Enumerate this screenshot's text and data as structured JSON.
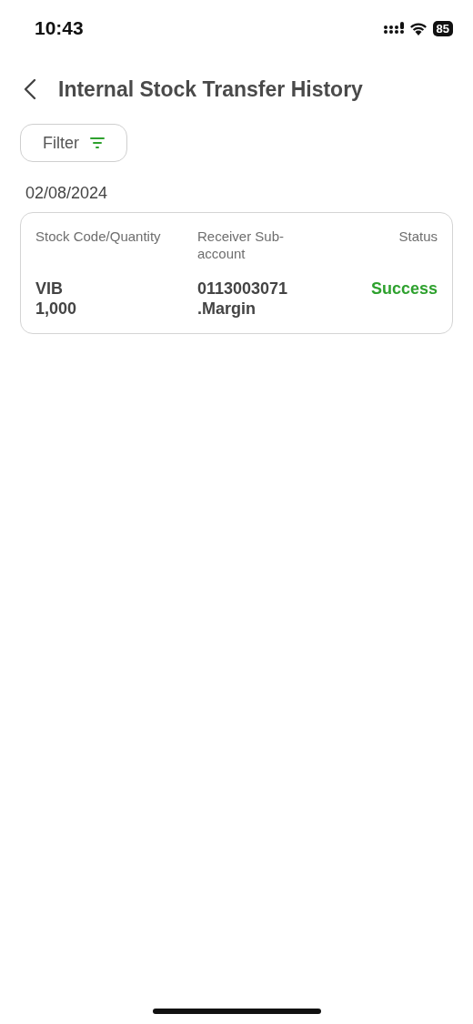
{
  "status_bar": {
    "time": "10:43",
    "battery": "85"
  },
  "header": {
    "title": "Internal Stock Transfer History"
  },
  "filter": {
    "label": "Filter"
  },
  "groups": [
    {
      "date": "02/08/2024",
      "records": [
        {
          "columns": [
            "Stock Code/Quantity",
            "Receiver Sub-account",
            "Status"
          ],
          "stock_code": "VIB",
          "quantity": "1,000",
          "sub_account": [
            "0113003071",
            ".Margin"
          ],
          "status": "Success",
          "color": "#2ea12e"
        }
      ]
    }
  ]
}
